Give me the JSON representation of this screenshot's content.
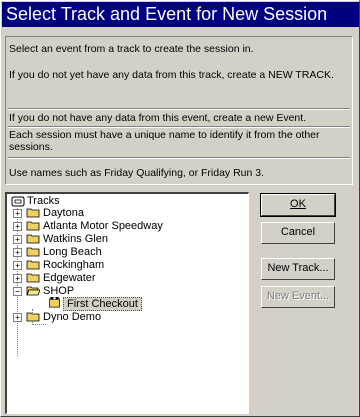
{
  "window": {
    "title": "Select Track and Event for New Session"
  },
  "instructions": {
    "line1": "Select an event from a track to create the session in.",
    "line2": "If you do not yet have any data from this track, create a NEW TRACK.",
    "line3": "If you do not have any data from this event, create a new Event.",
    "line4": "Each session must have a unique name to identify it from the other sessions.",
    "line5": "Use names such as Friday Qualifying, or Friday Run 3."
  },
  "tree": {
    "root": "Tracks",
    "tracks": [
      {
        "label": "Daytona",
        "expanded": false
      },
      {
        "label": "Atlanta Motor Speedway",
        "expanded": false
      },
      {
        "label": "Watkins Glen",
        "expanded": false
      },
      {
        "label": "Long Beach",
        "expanded": false
      },
      {
        "label": "Rockingham",
        "expanded": false
      },
      {
        "label": "Edgewater",
        "expanded": false
      },
      {
        "label": "SHOP",
        "expanded": true
      },
      {
        "label": "First Checkout",
        "expanded": false,
        "child": true,
        "selected": true
      },
      {
        "label": "Dyno Demo",
        "expanded": false
      }
    ]
  },
  "buttons": {
    "ok": "OK",
    "cancel": "Cancel",
    "new_track": "New Track...",
    "new_event": "New Event..."
  },
  "colors": {
    "titlebar": "#000080",
    "folder": "#f0d060"
  }
}
